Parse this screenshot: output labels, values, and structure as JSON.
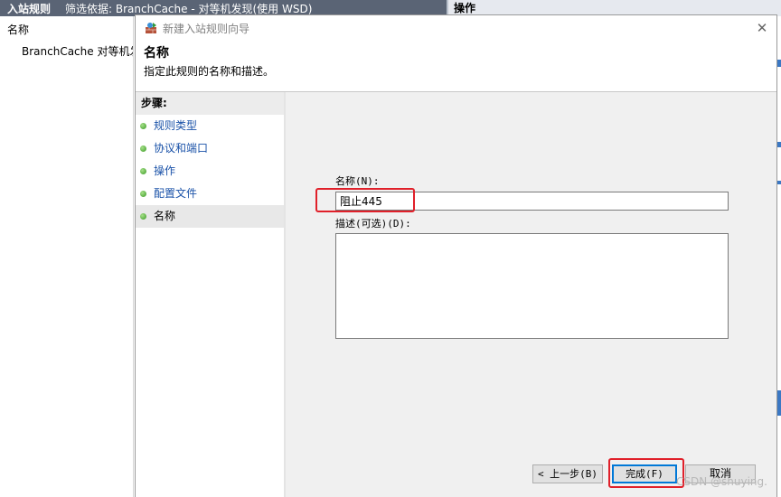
{
  "background_window": {
    "title": "入站规则",
    "filter_text": "筛选依据: BranchCache - 对等机发现(使用 WSD)",
    "action_pane_title": "操作",
    "list_header": "名称",
    "list_rows": [
      "BranchCache 对等机发"
    ]
  },
  "dialog": {
    "title": "新建入站规则向导",
    "close_glyph": "✕",
    "heading": "名称",
    "subheading": "指定此规则的名称和描述。",
    "steps_title": "步骤:",
    "steps": [
      {
        "label": "规则类型",
        "active": false
      },
      {
        "label": "协议和端口",
        "active": false
      },
      {
        "label": "操作",
        "active": false
      },
      {
        "label": "配置文件",
        "active": false
      },
      {
        "label": "名称",
        "active": true
      }
    ],
    "name_label": "名称(N):",
    "name_value": "阻止445",
    "description_label": "描述(可选)(D):",
    "description_value": "",
    "buttons": {
      "back": "< 上一步(B)",
      "finish": "完成(F)",
      "cancel": "取消"
    },
    "highlight_color": "#e0202a"
  },
  "watermark": "CSDN @shuying."
}
